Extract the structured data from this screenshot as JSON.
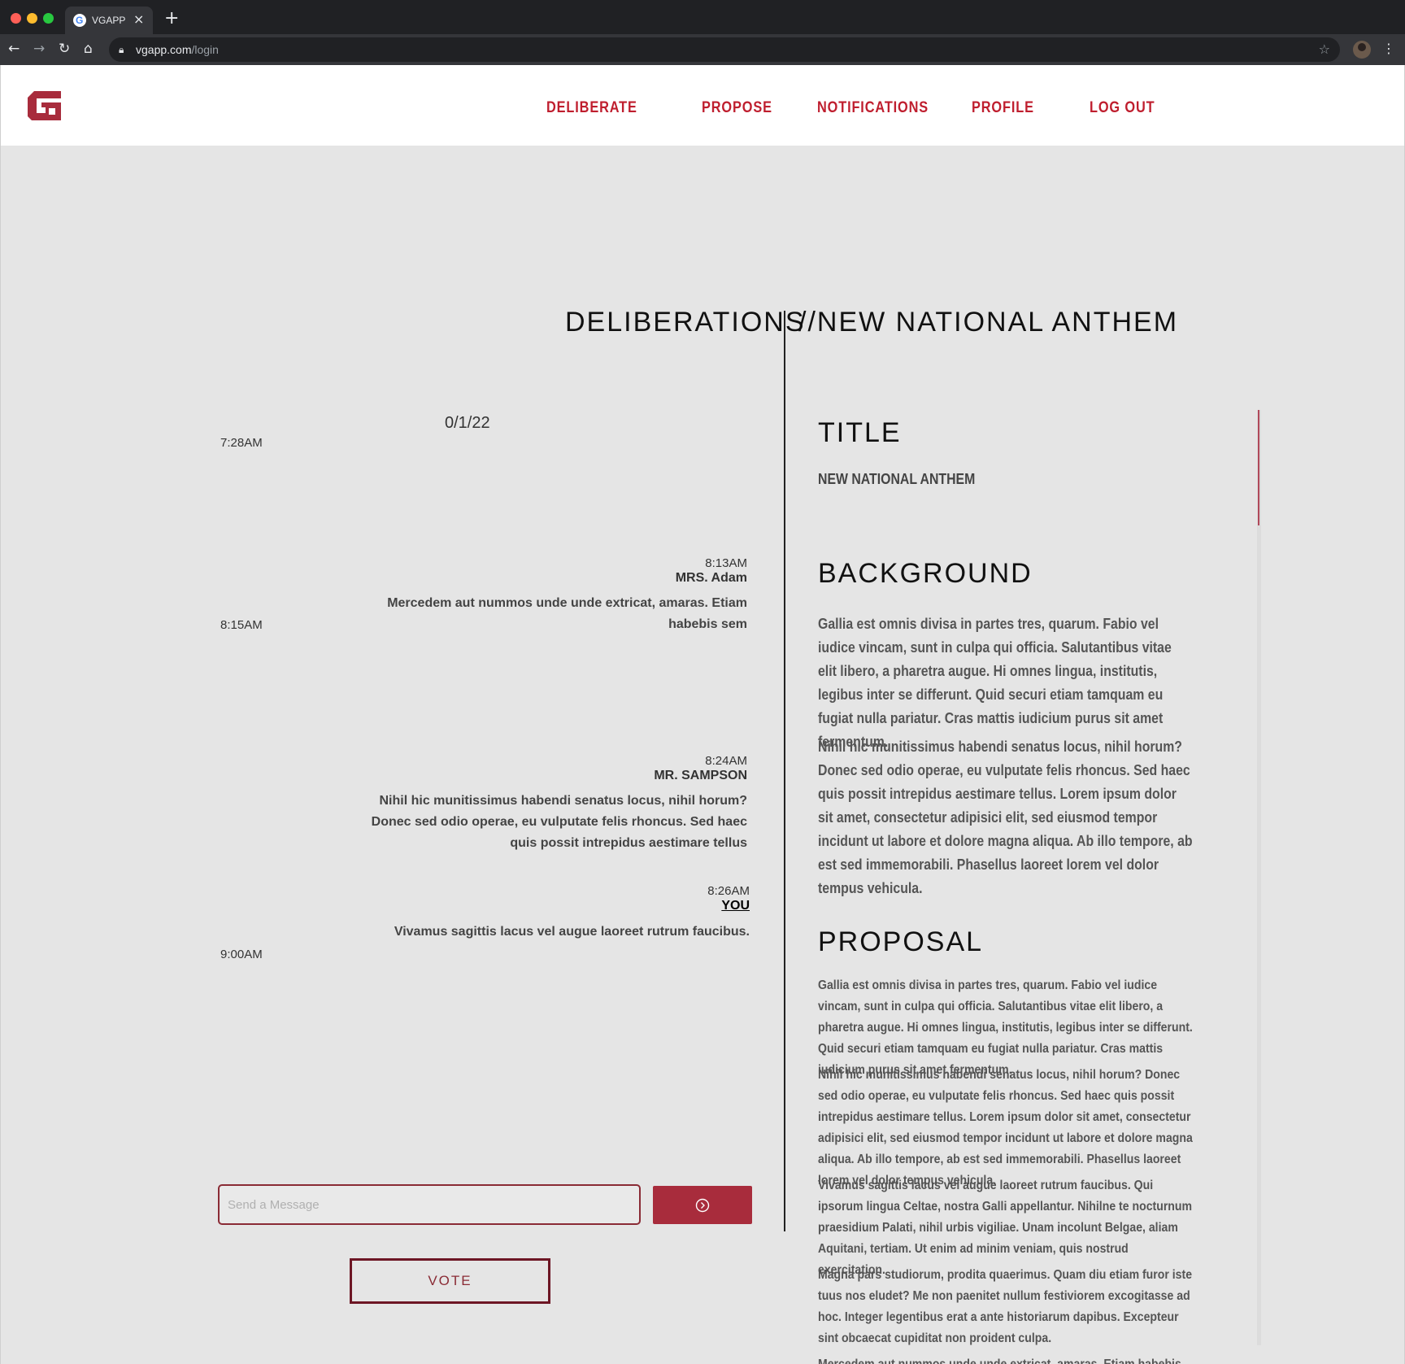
{
  "browser": {
    "tab_title": "VGAPP",
    "tab_close": "×",
    "new_tab": "+",
    "url_host": "vgapp.com",
    "url_path": "/login"
  },
  "header": {
    "nav": [
      "DELIBERATE",
      "PROPOSE",
      "NOTIFICATIONS",
      "PROFILE",
      "LOG OUT"
    ]
  },
  "deliberations": {
    "heading": "DELIBERATIONS",
    "date": "0/1/22",
    "time_markers": [
      "7:28AM",
      "8:15AM",
      "9:00AM"
    ],
    "messages": [
      {
        "time": "8:13AM",
        "sender": "MRS. Adam",
        "text": "Mercedem aut nummos unde unde extricat, amaras. Etiam habebis sem"
      },
      {
        "time": "8:24AM",
        "sender": "MR. SAMPSON",
        "text": "Nihil hic munitissimus habendi senatus locus, nihil horum? Donec sed odio operae, eu vulputate felis rhoncus. Sed haec quis possit intrepidus aestimare tellus"
      },
      {
        "time": "8:26AM",
        "sender": "YOU",
        "text": "Vivamus sagittis lacus vel augue laoreet rutrum faucibus."
      }
    ],
    "input_placeholder": "Send a Message",
    "vote_label": "VOTE"
  },
  "proposal": {
    "heading": "//NEW NATIONAL ANTHEM",
    "title_label": "TITLE",
    "title_value": "NEW NATIONAL ANTHEM",
    "background_label": "BACKGROUND",
    "background": [
      "Gallia est omnis divisa in partes tres, quarum. Fabio vel iudice vincam, sunt in culpa qui officia. Salutantibus vitae elit libero, a pharetra augue. Hi omnes lingua, institutis, legibus inter se differunt. Quid securi etiam tamquam eu fugiat nulla pariatur. Cras mattis iudicium purus sit amet fermentum.",
      "Nihil hic munitissimus habendi senatus locus, nihil horum? Donec sed odio operae, eu vulputate felis rhoncus. Sed haec quis possit intrepidus aestimare tellus. Lorem ipsum dolor sit amet, consectetur adipisici elit, sed eiusmod tempor incidunt ut labore et dolore magna aliqua. Ab illo tempore, ab est sed immemorabili. Phasellus laoreet lorem vel dolor tempus vehicula."
    ],
    "proposal_label": "PROPOSAL",
    "proposal": [
      "Gallia est omnis divisa in partes tres, quarum. Fabio vel iudice vincam, sunt in culpa qui officia. Salutantibus vitae elit libero, a pharetra augue. Hi omnes lingua, institutis, legibus inter se differunt. Quid securi etiam tamquam eu fugiat nulla pariatur. Cras mattis iudicium purus sit amet fermentum.",
      "Nihil hic munitissimus habendi senatus locus, nihil horum? Donec sed odio operae, eu vulputate felis rhoncus. Sed haec quis possit intrepidus aestimare tellus. Lorem ipsum dolor sit amet, consectetur adipisici elit, sed eiusmod tempor incidunt ut labore et dolore magna aliqua. Ab illo tempore, ab est sed immemorabili. Phasellus laoreet lorem vel dolor tempus vehicula.",
      "Vivamus sagittis lacus vel augue laoreet rutrum faucibus. Qui ipsorum lingua Celtae, nostra Galli appellantur. Nihilne te nocturnum praesidium Palati, nihil urbis vigiliae. Unam incolunt Belgae, aliam Aquitani, tertiam. Ut enim ad minim veniam, quis nostrud exercitation.",
      "Magna pars studiorum, prodita quaerimus. Quam diu etiam furor iste tuus nos eludet? Me non paenitet nullum festiviorem excogitasse ad hoc. Integer legentibus erat a ante historiarum dapibus. Excepteur sint obcaecat cupiditat non proident culpa.",
      "Mercedem aut nummos unde unde extricat, amaras. Etiam habebis sem"
    ]
  },
  "colors": {
    "accent": "#bf1e2e",
    "button": "#a82c3c",
    "vote_border": "#6d1624",
    "page_bg": "#e5e5e5"
  }
}
